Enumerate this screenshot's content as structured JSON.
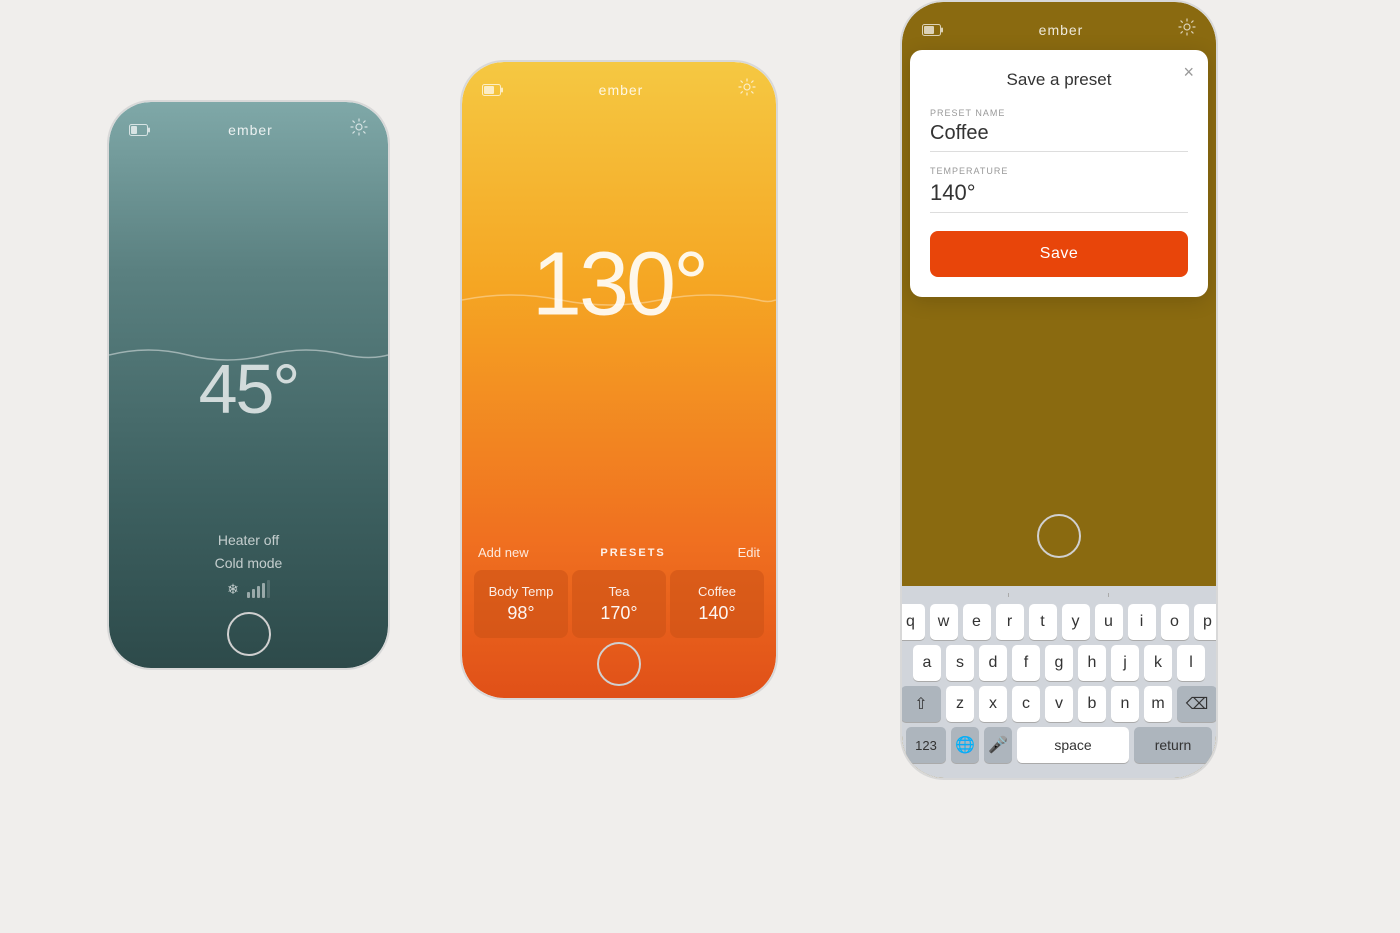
{
  "background": "#f0eeec",
  "phone1": {
    "title": "ember",
    "temperature": "45°",
    "status_line1": "Heater off",
    "status_line2": "Cold mode",
    "wave_color": "rgba(255,255,255,0.4)"
  },
  "phone2": {
    "title": "ember",
    "temperature": "130°",
    "presets_label": "PRESETS",
    "add_label": "Add new",
    "edit_label": "Edit",
    "presets": [
      {
        "name": "Body Temp",
        "temp": "98°"
      },
      {
        "name": "Tea",
        "temp": "170°"
      },
      {
        "name": "Coffee",
        "temp": "140°"
      }
    ]
  },
  "phone3": {
    "title": "ember",
    "dialog": {
      "title": "Save a preset",
      "preset_name_label": "PRESET NAME",
      "preset_name_value": "Coffee",
      "temperature_label": "TEMPERATURE",
      "temperature_value": "140°",
      "save_button": "Save"
    },
    "keyboard": {
      "suggestions": [
        "",
        "",
        ""
      ],
      "row1": [
        "q",
        "w",
        "e",
        "r",
        "t",
        "y",
        "u",
        "i",
        "o",
        "p"
      ],
      "row2": [
        "a",
        "s",
        "d",
        "f",
        "g",
        "h",
        "j",
        "k",
        "l"
      ],
      "row3": [
        "z",
        "x",
        "c",
        "v",
        "b",
        "n",
        "m"
      ],
      "bottom": [
        "123",
        "🌐",
        "🎤",
        "space",
        "return"
      ]
    }
  }
}
